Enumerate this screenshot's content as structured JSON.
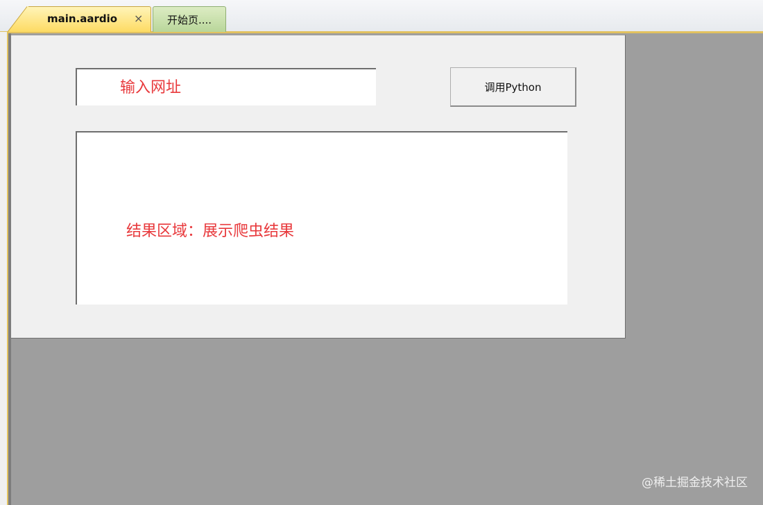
{
  "tabs": {
    "active": {
      "label": "main.aardio",
      "close_symbol": "×"
    },
    "inactive": {
      "label": "开始页...."
    }
  },
  "form": {
    "url_input": {
      "placeholder": "输入网址",
      "value": ""
    },
    "call_button_label": "调用Python",
    "result_text": "结果区域：展示爬虫结果"
  },
  "watermark": "@稀土掘金技术社区",
  "colors": {
    "accent_red": "#e8393c",
    "tab_active": "#fddb63",
    "tab_inactive": "#b9d69a",
    "workspace": "#9e9e9e"
  }
}
